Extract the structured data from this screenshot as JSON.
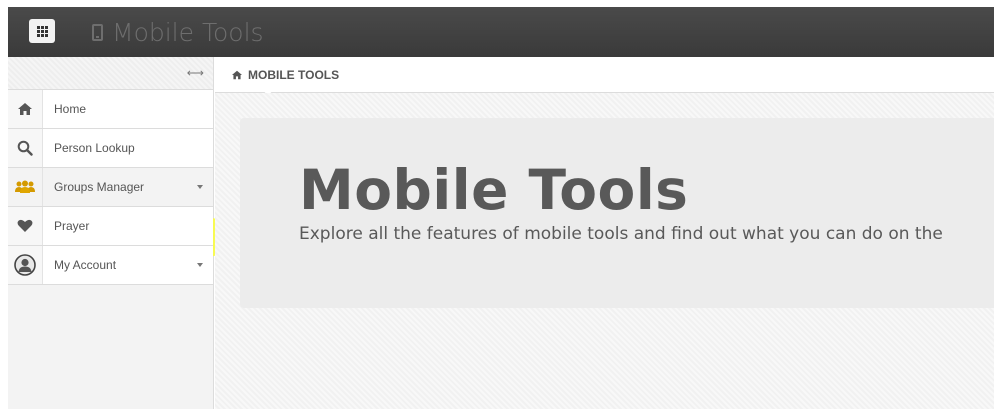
{
  "app": {
    "title": "Mobile Tools"
  },
  "sidebar": {
    "items": [
      {
        "label": "Home"
      },
      {
        "label": "Person Lookup"
      },
      {
        "label": "Groups Manager"
      },
      {
        "label": "Prayer"
      },
      {
        "label": "My Account"
      }
    ]
  },
  "breadcrumb": {
    "label": "MOBILE TOOLS"
  },
  "main": {
    "title": "Mobile Tools",
    "subtitle": "Explore all the features of mobile tools and find out what you can do on the"
  },
  "colors": {
    "highlight": "#f8fb4a",
    "topbar": "#3f3f3f",
    "groups_icon": "#e0a600"
  },
  "icons": [
    "grid-icon",
    "phone-icon",
    "arrows-horizontal-icon",
    "home-icon",
    "search-icon",
    "users-icon",
    "heart-icon",
    "avatar-icon"
  ]
}
